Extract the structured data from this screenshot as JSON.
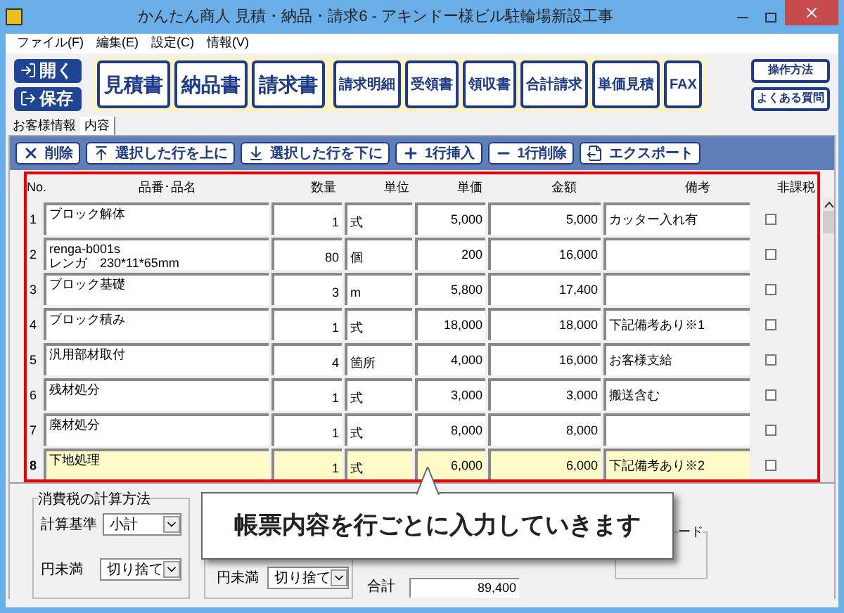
{
  "window": {
    "title": "かんたん商人 見積・納品・請求6 - アキンドー様ビル駐輪場新設工事"
  },
  "menu": [
    "ファイル(F)",
    "編集(E)",
    "設定(C)",
    "情報(V)"
  ],
  "file_buttons": [
    {
      "label": "開く",
      "kind": "open"
    },
    {
      "label": "保存",
      "kind": "save"
    }
  ],
  "doc_buttons": [
    {
      "label": "見積書",
      "kind": "large"
    },
    {
      "label": "納品書",
      "kind": "large"
    },
    {
      "label": "請求書",
      "kind": "large"
    },
    {
      "label": "請求明細",
      "kind": "small"
    },
    {
      "label": "受領書",
      "kind": "small"
    },
    {
      "label": "領収書",
      "kind": "small"
    },
    {
      "label": "合計請求",
      "kind": "small"
    },
    {
      "label": "単価見積",
      "kind": "small"
    },
    {
      "label": "FAX",
      "kind": "small"
    }
  ],
  "help_buttons": [
    "操作方法",
    "よくある質問"
  ],
  "tabs": [
    {
      "label": "お客様情報",
      "selected": false
    },
    {
      "label": "内容",
      "selected": true
    }
  ],
  "actions": [
    {
      "label": "削除",
      "kind": "delete"
    },
    {
      "label": "選択した行を上に",
      "kind": "up"
    },
    {
      "label": "選択した行を下に",
      "kind": "down"
    },
    {
      "label": "1行挿入",
      "kind": "insert"
    },
    {
      "label": "1行削除",
      "kind": "remove"
    },
    {
      "label": "エクスポート",
      "kind": "export"
    }
  ],
  "table": {
    "columns": [
      "No.",
      "品番･品名",
      "数量",
      "単位",
      "単価",
      "金額",
      "備考",
      "非課税"
    ],
    "rows": [
      {
        "no": "1",
        "name": "ブロック解体",
        "qty": "1",
        "unit": "式",
        "price": "5,000",
        "amount": "5,000",
        "note": "カッター入れ有",
        "tax_exempt": false,
        "selected": false
      },
      {
        "no": "2",
        "name": "renga-b001s\nレンガ　230*11*65mm",
        "qty": "80",
        "unit": "個",
        "price": "200",
        "amount": "16,000",
        "note": "",
        "tax_exempt": false,
        "selected": false
      },
      {
        "no": "3",
        "name": "ブロック基礎",
        "qty": "3",
        "unit": "m",
        "price": "5,800",
        "amount": "17,400",
        "note": "",
        "tax_exempt": false,
        "selected": false
      },
      {
        "no": "4",
        "name": "ブロック積み",
        "qty": "1",
        "unit": "式",
        "price": "18,000",
        "amount": "18,000",
        "note": "下記備考あり※1",
        "tax_exempt": false,
        "selected": false
      },
      {
        "no": "5",
        "name": "汎用部材取付",
        "qty": "4",
        "unit": "箇所",
        "price": "4,000",
        "amount": "16,000",
        "note": "お客様支給",
        "tax_exempt": false,
        "selected": false
      },
      {
        "no": "6",
        "name": "残材処分",
        "qty": "1",
        "unit": "式",
        "price": "3,000",
        "amount": "3,000",
        "note": "搬送含む",
        "tax_exempt": false,
        "selected": false
      },
      {
        "no": "7",
        "name": "廃材処分",
        "qty": "1",
        "unit": "式",
        "price": "8,000",
        "amount": "8,000",
        "note": "",
        "tax_exempt": false,
        "selected": false
      },
      {
        "no": "8",
        "name": "下地処理",
        "qty": "1",
        "unit": "式",
        "price": "6,000",
        "amount": "6,000",
        "note": "下記備考あり※2",
        "tax_exempt": false,
        "selected": true
      }
    ]
  },
  "calc_method": {
    "legend": "消費税の計算方法",
    "fields": [
      {
        "label": "計算基準",
        "value": "小計"
      },
      {
        "label": "円未満",
        "value": "切り捨て"
      }
    ]
  },
  "input_method": {
    "fields": [
      {
        "label": "円未満",
        "value": "切り捨て"
      }
    ]
  },
  "total": {
    "label": "合計",
    "value": "89,400"
  },
  "group_legend": "ード",
  "callout": {
    "text": "帳票内容を行ごとに入力していきます"
  }
}
